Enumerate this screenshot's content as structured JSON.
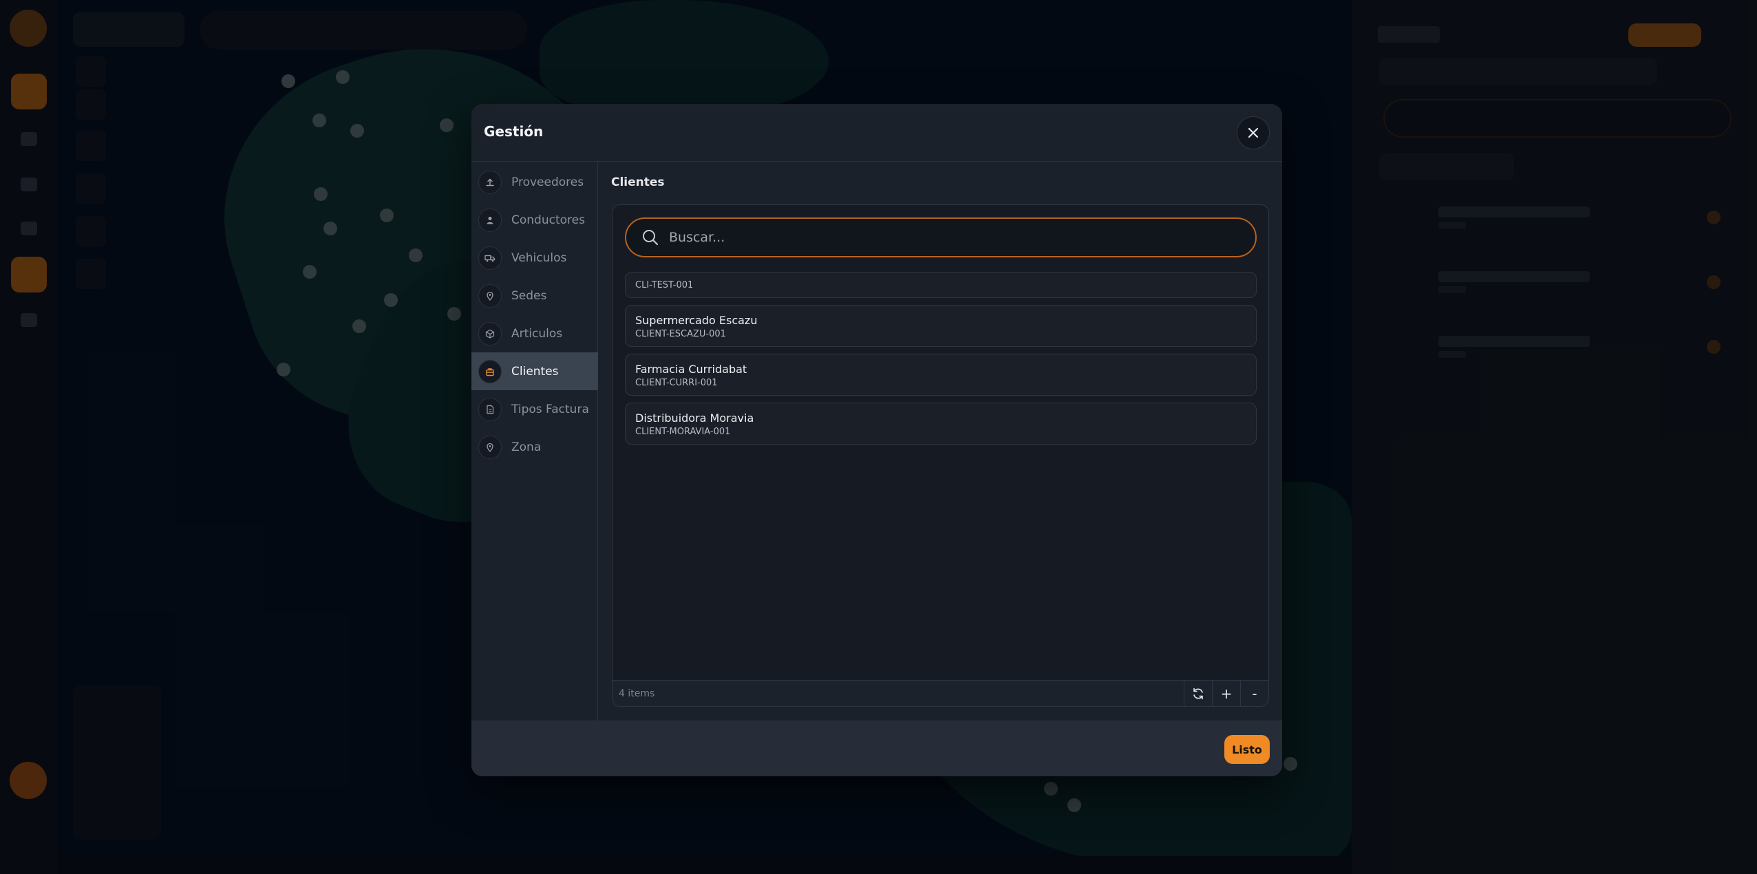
{
  "modal": {
    "title": "Gestión",
    "nav": [
      {
        "label": "Proveedores",
        "icon": "upload-icon"
      },
      {
        "label": "Conductores",
        "icon": "user-icon"
      },
      {
        "label": "Vehiculos",
        "icon": "truck-icon"
      },
      {
        "label": "Sedes",
        "icon": "location-pin-icon"
      },
      {
        "label": "Articulos",
        "icon": "box-icon"
      },
      {
        "label": "Clientes",
        "icon": "briefcase-icon",
        "active": true
      },
      {
        "label": "Tipos Factura",
        "icon": "document-icon"
      },
      {
        "label": "Zona",
        "icon": "location-pin-icon"
      }
    ],
    "section_title": "Clientes",
    "search": {
      "placeholder": "Buscar..."
    },
    "clients": [
      {
        "code": "CLI-TEST-001"
      },
      {
        "name": "Supermercado Escazu",
        "code": "CLIENT-ESCAZU-001"
      },
      {
        "name": "Farmacia Curridabat",
        "code": "CLIENT-CURRI-001"
      },
      {
        "name": "Distribuidora Moravia",
        "code": "CLIENT-MORAVIA-001"
      }
    ],
    "footer": {
      "count": "4 items",
      "add_label": "+",
      "remove_label": "-"
    },
    "done_label": "Listo"
  },
  "colors": {
    "accent": "#f08a24",
    "modal_bg": "#1b212b",
    "active_nav": "#3a4350"
  }
}
